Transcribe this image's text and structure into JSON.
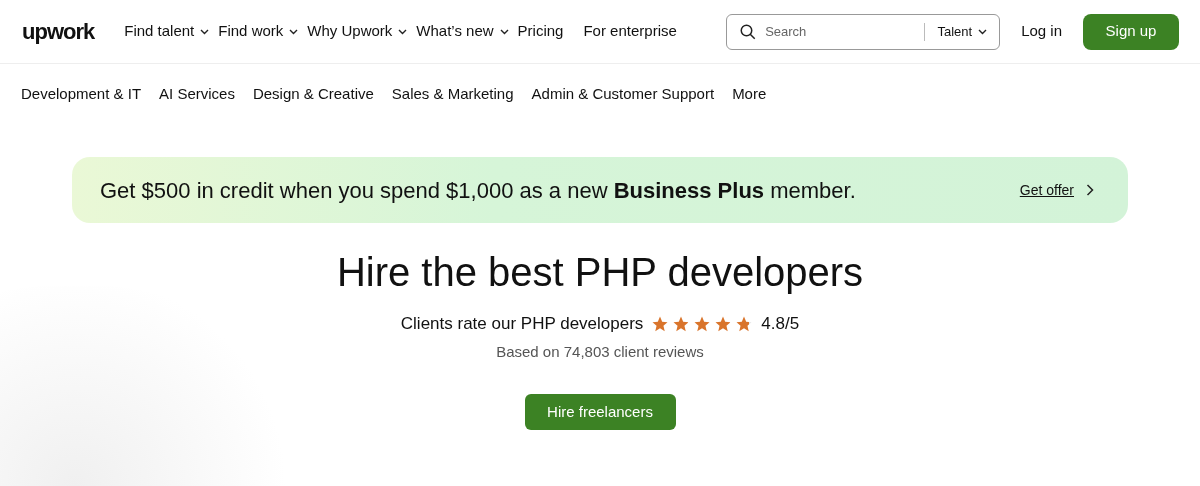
{
  "header": {
    "logo": "upwork",
    "nav": [
      {
        "label": "Find talent",
        "dropdown": true
      },
      {
        "label": "Find work",
        "dropdown": true
      },
      {
        "label": "Why Upwork",
        "dropdown": true
      },
      {
        "label": "What’s new",
        "dropdown": true
      },
      {
        "label": "Pricing",
        "dropdown": false
      },
      {
        "label": "For enterprise",
        "dropdown": false
      }
    ],
    "search": {
      "placeholder": "Search",
      "scope": "Talent"
    },
    "login": "Log in",
    "signup": "Sign up"
  },
  "categories": [
    "Development & IT",
    "AI Services",
    "Design & Creative",
    "Sales & Marketing",
    "Admin & Customer Support",
    "More"
  ],
  "promo": {
    "text": "Get $500 in credit when you spend $1,000 as a new **Business Plus** member.",
    "link": "Get offer"
  },
  "hero": {
    "title": "Hire the best PHP developers",
    "rating_label": "Clients rate our PHP developers",
    "stars": 4.8,
    "rating": "4.8/5",
    "reviews": "Based on 74,803 client reviews",
    "cta": "Hire freelancers"
  }
}
